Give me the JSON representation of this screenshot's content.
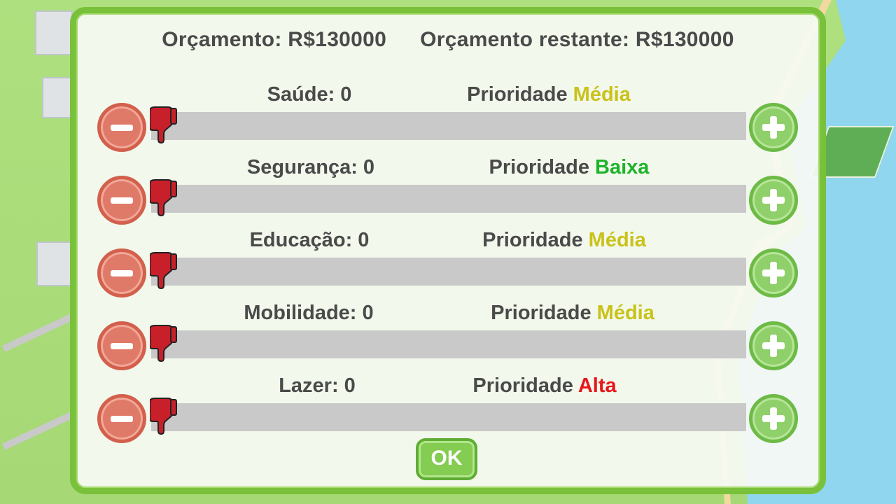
{
  "budget": {
    "total_label": "Orçamento: R$130000",
    "remaining_label": "Orçamento restante: R$130000"
  },
  "categories": [
    {
      "name_label": "Saúde: 0",
      "priority_prefix": "Prioridade",
      "priority_value": "Média",
      "priority_color": "#c9c21a",
      "progress": 0.0
    },
    {
      "name_label": "Segurança: 0",
      "priority_prefix": "Prioridade",
      "priority_value": "Baixa",
      "priority_color": "#1db32a",
      "progress": 0.0
    },
    {
      "name_label": "Educação: 0",
      "priority_prefix": "Prioridade",
      "priority_value": "Média",
      "priority_color": "#c9c21a",
      "progress": 0.0
    },
    {
      "name_label": "Mobilidade: 0",
      "priority_prefix": "Prioridade",
      "priority_value": "Média",
      "priority_color": "#c9c21a",
      "progress": 0.0
    },
    {
      "name_label": "Lazer: 0",
      "priority_prefix": "Prioridade",
      "priority_value": "Alta",
      "priority_color": "#e8161b",
      "progress": 0.0
    }
  ],
  "controls": {
    "decrease_icon": "minus-circle-icon",
    "increase_icon": "plus-circle-icon",
    "rating_icon": "thumbs-down-icon"
  },
  "ok_label": "OK",
  "colors": {
    "frame": "#79c13a",
    "minus_button": "#e07a68",
    "plus_button": "#8fd06a",
    "bar_track": "#c9c9c9",
    "thumb": "#c8202a"
  }
}
